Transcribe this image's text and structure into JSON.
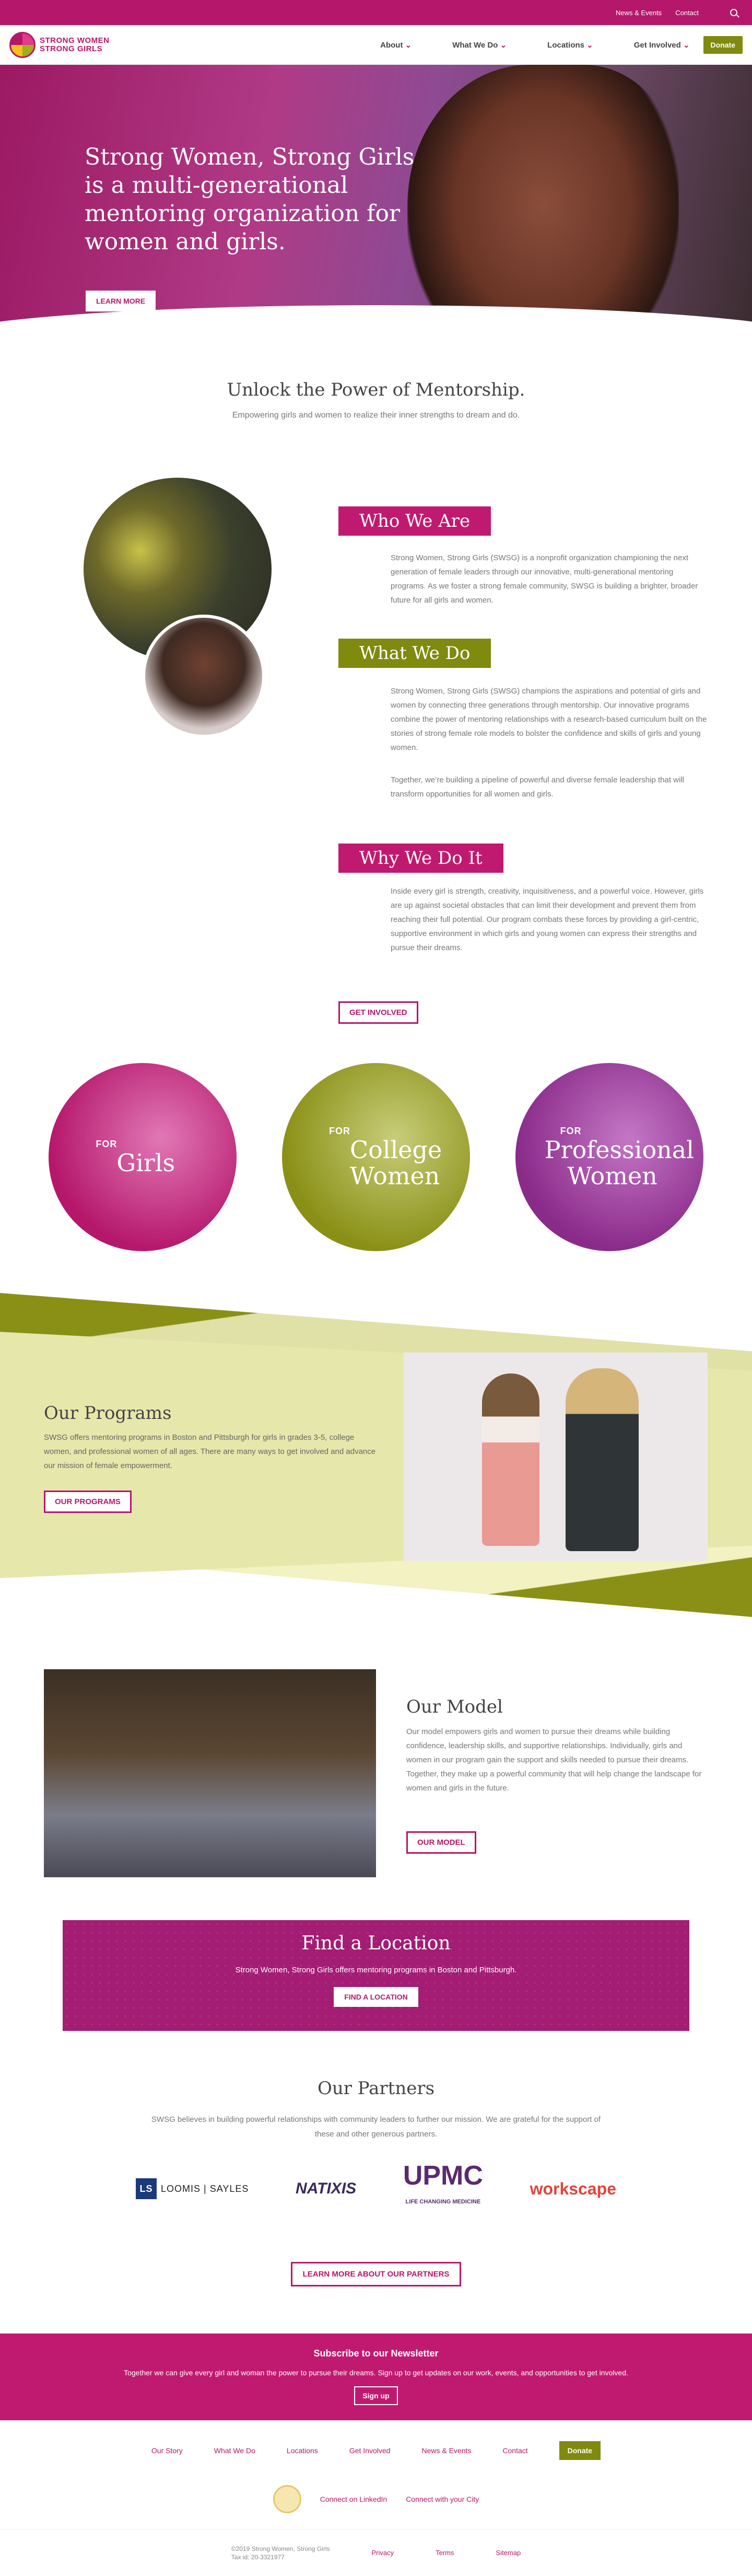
{
  "topbar": {
    "links": [
      "News & Events",
      "Contact"
    ]
  },
  "nav": {
    "logo_line1": "STRONG WOMEN",
    "logo_line2": "STRONG GIRLS",
    "items": [
      "About",
      "What We Do",
      "Locations",
      "Get Involved"
    ],
    "donate": "Donate"
  },
  "hero": {
    "headline": "Strong Women, Strong Girls is a multi-generational mentoring organization for women and girls.",
    "button": "LEARN MORE"
  },
  "unlock": {
    "title": "Unlock the Power of Mentorship.",
    "subtitle": "Empowering girls and women to realize their inner strengths to dream and do."
  },
  "who": {
    "title": "Who We Are",
    "text": "Strong Women, Strong Girls (SWSG) is a nonprofit organization championing the next generation of female leaders through our innovative, multi-generational mentoring programs. As we foster a strong female community, SWSG is building a brighter, broader future for all girls and women."
  },
  "what": {
    "title": "What We Do",
    "text1": "Strong Women, Strong Girls (SWSG) champions the aspirations and potential of girls and women by connecting three generations through mentorship. Our innovative programs combine the power of mentoring relationships with a research-based curriculum built on the stories of strong female role models to bolster the confidence and skills of girls and young women.",
    "text2": "Together, we’re building a pipeline of powerful and diverse female leadership that will transform opportunities for all women and girls."
  },
  "why": {
    "title": "Why We Do It",
    "text": "Inside every girl is strength, creativity, inquisitiveness, and a powerful voice. However, girls are up against societal obstacles that can limit their development and prevent them from reaching their full potential. Our program combats these forces by providing a girl-centric, supportive environment in which girls and young women can express their strengths and pursue their dreams.",
    "button": "GET INVOLVED"
  },
  "audiences": [
    {
      "for": "FOR",
      "who": "Girls"
    },
    {
      "for": "FOR",
      "who": "College Women"
    },
    {
      "for": "FOR",
      "who": "Professional Women"
    }
  ],
  "programs": {
    "title": "Our Programs",
    "text": "SWSG offers mentoring programs in Boston and Pittsburgh for girls in grades 3-5, college women, and professional women of all ages. There are many ways to get involved and advance our mission of female empowerment.",
    "button": "OUR PROGRAMS"
  },
  "model": {
    "title": "Our Model",
    "text": "Our model empowers girls and women to pursue their dreams while building confidence, leadership skills, and supportive relationships. Individually, girls and women in our program gain the support and skills needed to pursue their dreams. Together, they make up a powerful community that will help change the landscape for women and girls in the future.",
    "button": "OUR MODEL"
  },
  "location": {
    "title": "Find a Location",
    "text": "Strong Women, Strong Girls offers mentoring programs in Boston and Pittsburgh.",
    "button": "FIND A LOCATION"
  },
  "partners": {
    "title": "Our Partners",
    "text": "SWSG believes in building powerful relationships with community leaders to further our mission. We are grateful for the support of these and other generous partners.",
    "logo1": "LOOMIS | SAYLES",
    "logo1_mark": "LS",
    "logo2": "NATIXIS",
    "logo3": "UPMC",
    "logo3_sub": "LIFE CHANGING MEDICINE",
    "logo4": "workscape",
    "button": "LEARN MORE ABOUT OUR PARTNERS"
  },
  "newsletter": {
    "title": "Subscribe to our Newsletter",
    "text": "Together we can give every girl and woman the power to pursue their dreams. Sign up to get updates on our work, events, and opportunities to get involved.",
    "button": "Sign up"
  },
  "footer": {
    "links": [
      "Our Story",
      "What We Do",
      "Locations",
      "Get Involved",
      "News & Events",
      "Contact"
    ],
    "donate": "Donate",
    "linkedin": "Connect on LinkedIn",
    "city": "Connect with your City",
    "copyright": "©2019 Strong Women, Strong Girls",
    "tax": "Tax id: 20-3321977",
    "bottom_links": [
      "Privacy",
      "Terms",
      "Sitemap"
    ]
  },
  "colors": {
    "brand": "#b5176b",
    "accent_green": "#7f8a0f"
  }
}
